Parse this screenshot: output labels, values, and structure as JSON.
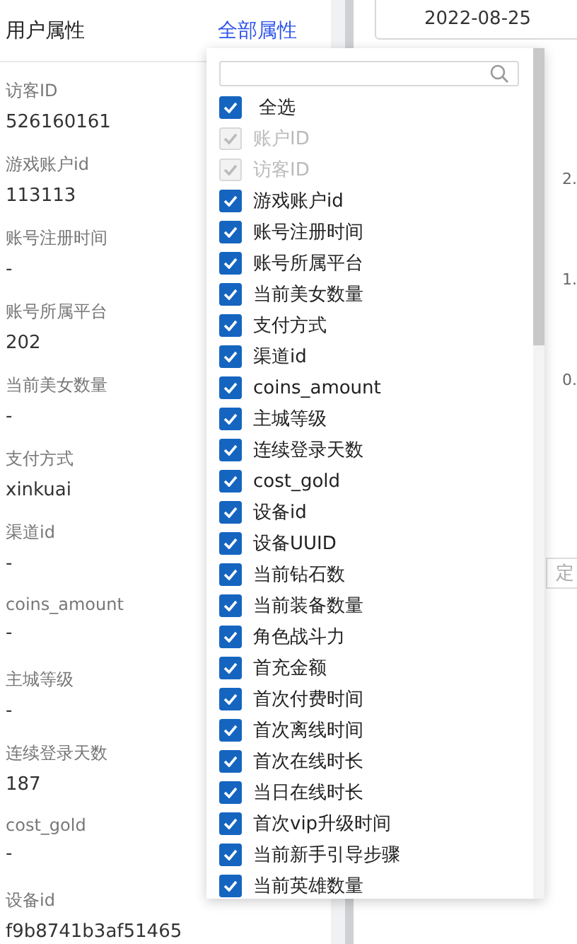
{
  "panel": {
    "title": "用户属性",
    "link": "全部属性"
  },
  "attributes": [
    {
      "label": "访客ID",
      "value": "526160161"
    },
    {
      "label": "游戏账户id",
      "value": "113113"
    },
    {
      "label": "账号注册时间",
      "value": "-"
    },
    {
      "label": "账号所属平台",
      "value": "202"
    },
    {
      "label": "当前美女数量",
      "value": "-"
    },
    {
      "label": "支付方式",
      "value": "xinkuai"
    },
    {
      "label": "渠道id",
      "value": "-"
    },
    {
      "label": "coins_amount",
      "value": "-"
    },
    {
      "label": "主城等级",
      "value": "-"
    },
    {
      "label": "连续登录天数",
      "value": "187"
    },
    {
      "label": "cost_gold",
      "value": "-"
    },
    {
      "label": "设备id",
      "value": "f9b8741b3af51465"
    }
  ],
  "date": "2022-08-25",
  "axis_labels": [
    "2.",
    "1.",
    "0."
  ],
  "locate_button": "定",
  "dropdown": {
    "items": [
      {
        "label": "全选",
        "checked": true,
        "disabled": false
      },
      {
        "label": "账户ID",
        "checked": true,
        "disabled": true
      },
      {
        "label": "访客ID",
        "checked": true,
        "disabled": true
      },
      {
        "label": "游戏账户id",
        "checked": true,
        "disabled": false
      },
      {
        "label": "账号注册时间",
        "checked": true,
        "disabled": false
      },
      {
        "label": "账号所属平台",
        "checked": true,
        "disabled": false
      },
      {
        "label": "当前美女数量",
        "checked": true,
        "disabled": false
      },
      {
        "label": "支付方式",
        "checked": true,
        "disabled": false
      },
      {
        "label": "渠道id",
        "checked": true,
        "disabled": false
      },
      {
        "label": "coins_amount",
        "checked": true,
        "disabled": false
      },
      {
        "label": "主城等级",
        "checked": true,
        "disabled": false
      },
      {
        "label": "连续登录天数",
        "checked": true,
        "disabled": false
      },
      {
        "label": "cost_gold",
        "checked": true,
        "disabled": false
      },
      {
        "label": "设备id",
        "checked": true,
        "disabled": false
      },
      {
        "label": "设备UUID",
        "checked": true,
        "disabled": false
      },
      {
        "label": "当前钻石数",
        "checked": true,
        "disabled": false
      },
      {
        "label": "当前装备数量",
        "checked": true,
        "disabled": false
      },
      {
        "label": "角色战斗力",
        "checked": true,
        "disabled": false
      },
      {
        "label": "首充金额",
        "checked": true,
        "disabled": false
      },
      {
        "label": "首次付费时间",
        "checked": true,
        "disabled": false
      },
      {
        "label": "首次离线时间",
        "checked": true,
        "disabled": false
      },
      {
        "label": "首次在线时长",
        "checked": true,
        "disabled": false
      },
      {
        "label": "当日在线时长",
        "checked": true,
        "disabled": false
      },
      {
        "label": "首次vip升级时间",
        "checked": true,
        "disabled": false
      },
      {
        "label": "当前新手引导步骤",
        "checked": true,
        "disabled": false
      },
      {
        "label": "当前英雄数量",
        "checked": true,
        "disabled": false
      }
    ]
  }
}
